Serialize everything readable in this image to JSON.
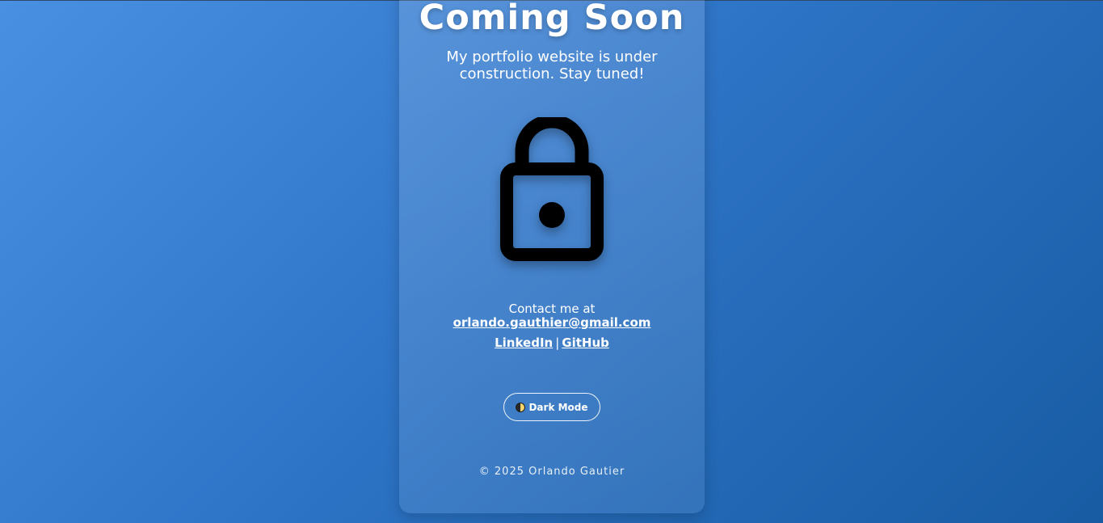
{
  "header": {
    "title": "Coming Soon",
    "subtitle": "My portfolio website is under construction. Stay tuned!"
  },
  "icons": {
    "hero": "lock-icon",
    "mode": "half-moon-icon"
  },
  "contact": {
    "prefix": "Contact me at",
    "email": "orlando.gauthier@gmail.com"
  },
  "links": {
    "linkedin": "LinkedIn",
    "separator": "|",
    "github": "GitHub"
  },
  "toggle": {
    "label": "Dark Mode"
  },
  "footer": {
    "copyright": "© 2025 Orlando Gautier"
  },
  "colors": {
    "background_start": "#4a90e2",
    "background_end": "#175ca3",
    "text": "#ffffff",
    "icon": "#000000"
  }
}
